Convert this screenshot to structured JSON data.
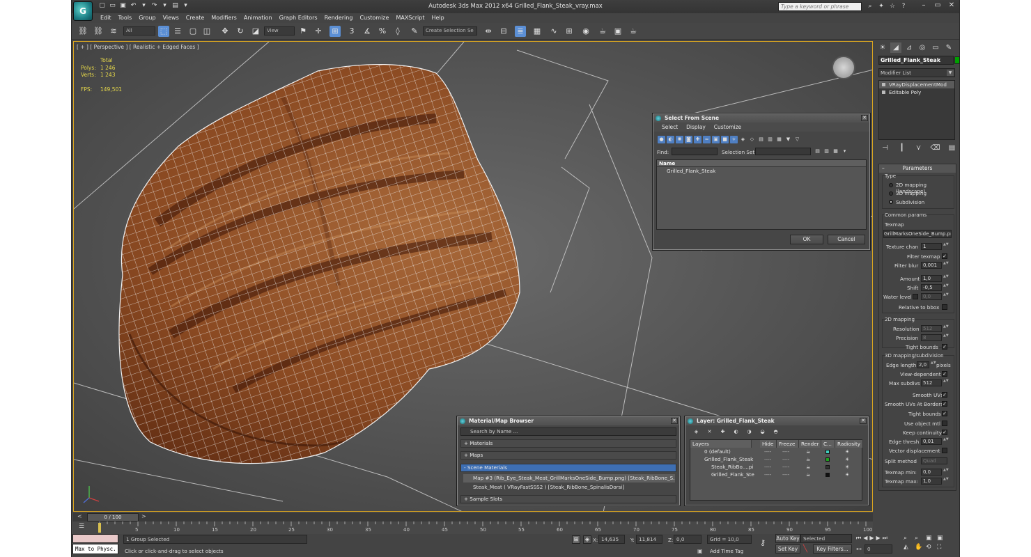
{
  "window": {
    "title": "Autodesk 3ds Max  2012 x64    Grilled_Flank_Steak_vray.max",
    "search_placeholder": "Type a keyword or phrase"
  },
  "menubar": [
    "Edit",
    "Tools",
    "Group",
    "Views",
    "Create",
    "Modifiers",
    "Animation",
    "Graph Editors",
    "Rendering",
    "Customize",
    "MAXScript",
    "Help"
  ],
  "toolbar": {
    "selection_filter": "All",
    "ref_coord": "View",
    "named_selection": "Create Selection Se"
  },
  "viewport": {
    "label": "[ + ] [ Perspective ] [ Realistic + Edged Faces ]",
    "stats": {
      "total_label": "Total",
      "polys_label": "Polys:",
      "polys_value": "1 246",
      "verts_label": "Verts:",
      "verts_value": "1 243",
      "fps_label": "FPS:",
      "fps_value": "149,501"
    }
  },
  "command_panel": {
    "object_name": "Grilled_Flank_Steak",
    "modifier_list": "Modifier List",
    "stack": [
      "VRayDisplacementMod",
      "Editable Poly"
    ],
    "rollout": "Parameters",
    "type_label": "Type",
    "type_options": [
      "2D mapping (landscape)",
      "3D mapping",
      "Subdivision"
    ],
    "common_params": "Common params",
    "texmap_label": "Texmap",
    "texmap_value": "GrillMarksOneSide_Bump.png)",
    "texture_chan_label": "Texture chan",
    "texture_chan_value": "1",
    "filter_texmap_label": "Filter texmap",
    "filter_blur_label": "Filter blur",
    "filter_blur_value": "0,001",
    "amount_label": "Amount",
    "amount_value": "1,0",
    "shift_label": "Shift",
    "shift_value": "-0,5",
    "water_level_label": "Water level",
    "water_level_value": "0,0",
    "relative_bbox_label": "Relative to bbox",
    "mapping2d_title": "2D mapping",
    "resolution_label": "Resolution",
    "resolution_value": "512",
    "precision_label": "Precision",
    "precision_value": "8",
    "tight_bounds_label": "Tight bounds",
    "mapping3d_title": "3D mapping/subdivision",
    "edge_length_label": "Edge length",
    "edge_length_value": "2,0",
    "pixels_label": "pixels",
    "view_dependent_label": "View-dependent",
    "max_subdivs_label": "Max subdivs",
    "max_subdivs_value": "512",
    "smooth_uvs_label": "Smooth UVs",
    "smooth_uvs_borders_label": "Smooth UVs At Borders",
    "tight_bounds2_label": "Tight bounds",
    "use_object_mtl_label": "Use object mtl",
    "keep_continuity_label": "Keep continuity",
    "edge_thresh_label": "Edge thresh",
    "edge_thresh_value": "0,01",
    "vector_disp_label": "Vector displacement",
    "split_method_label": "Split method",
    "split_method_value": "Quad",
    "texmap_min_label": "Texmap min:",
    "texmap_min_value": "0,0",
    "texmap_max_label": "Texmap max:",
    "texmap_max_value": "1,0"
  },
  "select_dialog": {
    "title": "Select From Scene",
    "menu": [
      "Select",
      "Display",
      "Customize"
    ],
    "find_label": "Find:",
    "selection_set_label": "Selection Set:",
    "col_name": "Name",
    "items": [
      "Grilled_Flank_Steak"
    ],
    "ok": "OK",
    "cancel": "Cancel"
  },
  "material_browser": {
    "title": "Material/Map Browser",
    "search": "Search by Name ...",
    "sections": [
      "+ Materials",
      "+ Maps",
      "- Scene Materials",
      "+ Sample Slots"
    ],
    "items": [
      "Map #3 (Rib_Eye_Steak_Meat_GrillMarksOneSide_Bump.png) [Steak_RibBone_S...",
      "Steak_Meat  ( VRayFastSSS2 ) [Steak_RibBone_SpinalisDorsi]"
    ]
  },
  "layer_dialog": {
    "title": "Layer: Grilled_Flank_Steak",
    "columns": [
      "Layers",
      "Hide",
      "Freeze",
      "Render",
      "C...",
      "Radiosity"
    ],
    "rows": [
      {
        "name": "0 (default)",
        "color": "#3fd0c0"
      },
      {
        "name": "Grilled_Flank_Steak",
        "color": "#1fa01f"
      },
      {
        "name": "Steak_RibBo....pi",
        "color": "#333333"
      },
      {
        "name": "Grilled_Flank_Ste",
        "color": "#111111"
      }
    ],
    "dash": "----"
  },
  "timeline": {
    "thumb": "0 / 100",
    "ticks": [
      "5",
      "10",
      "15",
      "20",
      "25",
      "30",
      "35",
      "40",
      "45",
      "50",
      "55",
      "60",
      "65",
      "70",
      "75",
      "80",
      "85",
      "90",
      "95",
      "100"
    ]
  },
  "status": {
    "macro_label": "Max to Physc.",
    "selection": "1 Group Selected",
    "prompt": "Click or click-and-drag to select objects",
    "x_label": "X:",
    "x_value": "14,635",
    "y_label": "Y:",
    "y_value": "11,814",
    "z_label": "Z:",
    "z_value": "0,0",
    "grid": "Grid = 10,0",
    "add_time_tag": "Add Time Tag",
    "auto_key": "Auto Key",
    "selected": "Selected",
    "set_key": "Set Key",
    "key_filters": "Key Filters...",
    "frame": "0"
  },
  "colors": {
    "accent": "#5b8fd5",
    "viewport_border": "#d9a520",
    "stats_text": "#e6d84a",
    "steak_dark": "#4a1e0c",
    "steak_mid": "#8b4a22",
    "steak_light": "#c58a56",
    "wire": "#f2f2f2"
  }
}
